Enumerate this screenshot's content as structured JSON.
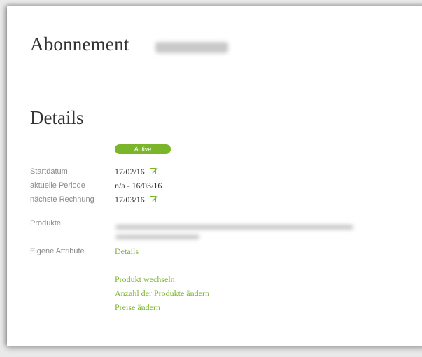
{
  "header": {
    "title": "Abonnement"
  },
  "details": {
    "heading": "Details",
    "status": "Active",
    "status_color": "#7ab52a",
    "rows": {
      "start_label": "Startdatum",
      "start_value": "17/02/16",
      "period_label": "aktuelle Periode",
      "period_value": "n/a - 16/03/16",
      "next_invoice_label": "nächste Rechnung",
      "next_invoice_value": "17/03/16",
      "products_label": "Produkte",
      "attributes_label": "Eigene Attribute",
      "attributes_link": "Details"
    }
  },
  "actions": {
    "change_product": "Produkt wechseln",
    "change_quantity": "Anzahl der Produkte ändern",
    "change_prices": "Preise ändern"
  },
  "icons": {
    "edit": "edit-icon"
  },
  "colors": {
    "accent": "#7ab52a",
    "label": "#8a8a8a",
    "text": "#333333"
  }
}
